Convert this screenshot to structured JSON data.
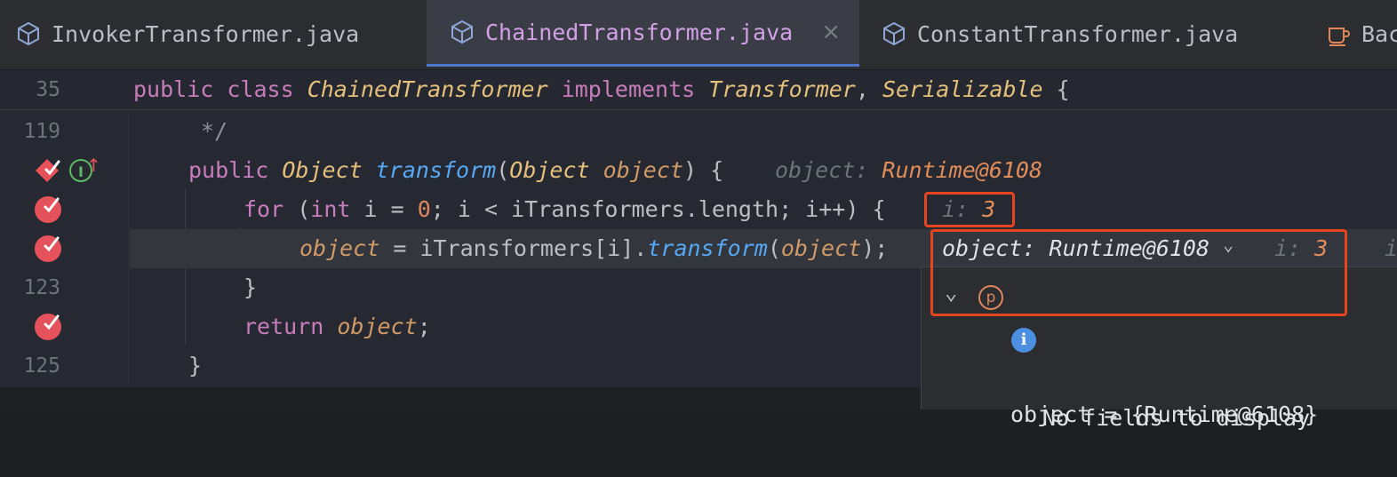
{
  "tabs": [
    {
      "label": "InvokerTransformer.java",
      "icon": "interface-icon"
    },
    {
      "label": "ChainedTransformer.java",
      "icon": "interface-icon",
      "active": true,
      "close": "×"
    },
    {
      "label": "ConstantTransformer.java",
      "icon": "interface-icon"
    },
    {
      "label": "Bac",
      "icon": "java-file-icon"
    }
  ],
  "sticky": {
    "line_number": "35",
    "code": {
      "kw_public": "public",
      "kw_class": "class",
      "class_name": "ChainedTransformer",
      "kw_implements": "implements",
      "iface1": "Transformer",
      "comma": ",",
      "iface2": "Serializable",
      "brace": "{"
    }
  },
  "lines": {
    "l119": {
      "number": "119",
      "text": "*/"
    },
    "l120": {
      "kw_public": "public",
      "ret_type": "Object",
      "method": "transform",
      "lparen": "(",
      "param_type": "Object",
      "param": "object",
      "rest": ") {",
      "hint_label": "object:",
      "hint_value": "Runtime@6108"
    },
    "l121": {
      "kw_for": "for",
      "p1": " (",
      "kw_int": "int",
      "p2": " i = ",
      "zero": "0",
      "p3": "; i < iTransformers.length; i++) {",
      "hint_label": "i:",
      "hint_value": "3"
    },
    "l122": {
      "var": "object",
      "p1": " = iTransformers[i].",
      "method": "transform",
      "p2": "(",
      "arg": "object",
      "p3": ");",
      "hint_obj_label": "object:",
      "hint_obj_value": "Runtime@6108",
      "chevron": "⌄",
      "hint_i_label": "i:",
      "hint_i_value": "3",
      "trailing": "i"
    },
    "l123": {
      "number": "123",
      "text": "}"
    },
    "l124": {
      "kw_return": "return",
      "var": "object",
      "semi": ";"
    },
    "l125": {
      "number": "125",
      "text": "}"
    }
  },
  "popup": {
    "expand_chevron": "⌄",
    "param_icon_letter": "p",
    "object_row": "object = {Runtime@6108}",
    "info_icon_letter": "i",
    "no_fields": "No fields to display"
  },
  "colors": {
    "accent_highlight": "#e4451f",
    "breakpoint": "#e5525b",
    "active_tab_text": "#d3a0e8"
  }
}
